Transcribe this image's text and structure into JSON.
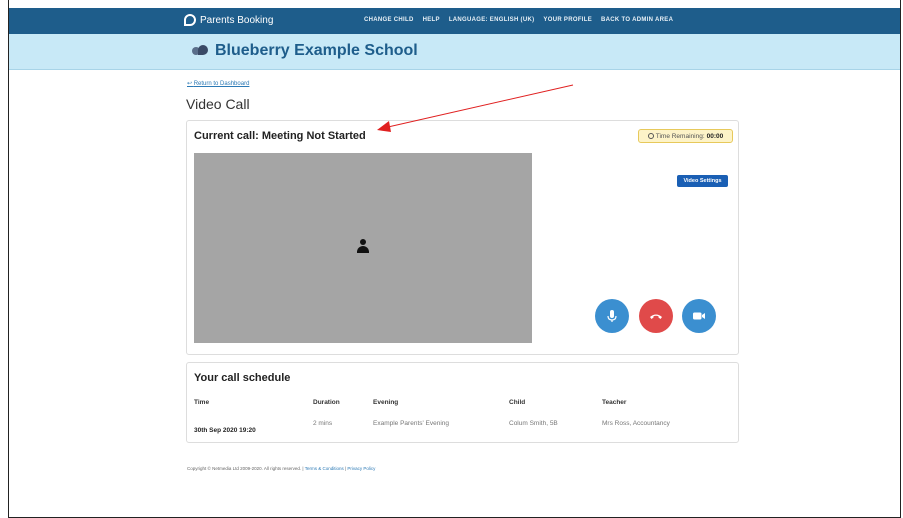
{
  "topbar": {
    "brand": "Parents Booking",
    "nav": [
      "CHANGE CHILD",
      "HELP",
      "LANGUAGE: ENGLISH (UK)",
      "YOUR PROFILE",
      "BACK TO ADMIN AREA"
    ]
  },
  "banner": {
    "school_name": "Blueberry Example School"
  },
  "page": {
    "return_link": "Return to Dashboard",
    "title": "Video Call"
  },
  "call": {
    "title": "Current call: Meeting Not Started",
    "time_label": "Time Remaining:",
    "time_value": "00:00",
    "settings_label": "Video Settings"
  },
  "schedule": {
    "title": "Your call schedule",
    "headers": [
      "Time",
      "Duration",
      "Evening",
      "Child",
      "Teacher"
    ],
    "row": {
      "time": "30th Sep 2020 19:20",
      "duration": "2 mins",
      "evening": "Example Parents' Evening",
      "child": "Colum Smith, 5B",
      "teacher": "Mrs Ross, Accountancy"
    }
  },
  "footer": {
    "copyright": "Copyright © Netmedia Ltd 2009-2020. All rights reserved. |",
    "terms": "Terms & Conditions",
    "privacy": "Privacy Policy"
  },
  "colors": {
    "topbar": "#1e5d8b",
    "banner": "#c8e9f7",
    "accent": "#3b8fd0",
    "hangup": "#e04a4a",
    "annotation": "#e02020"
  }
}
